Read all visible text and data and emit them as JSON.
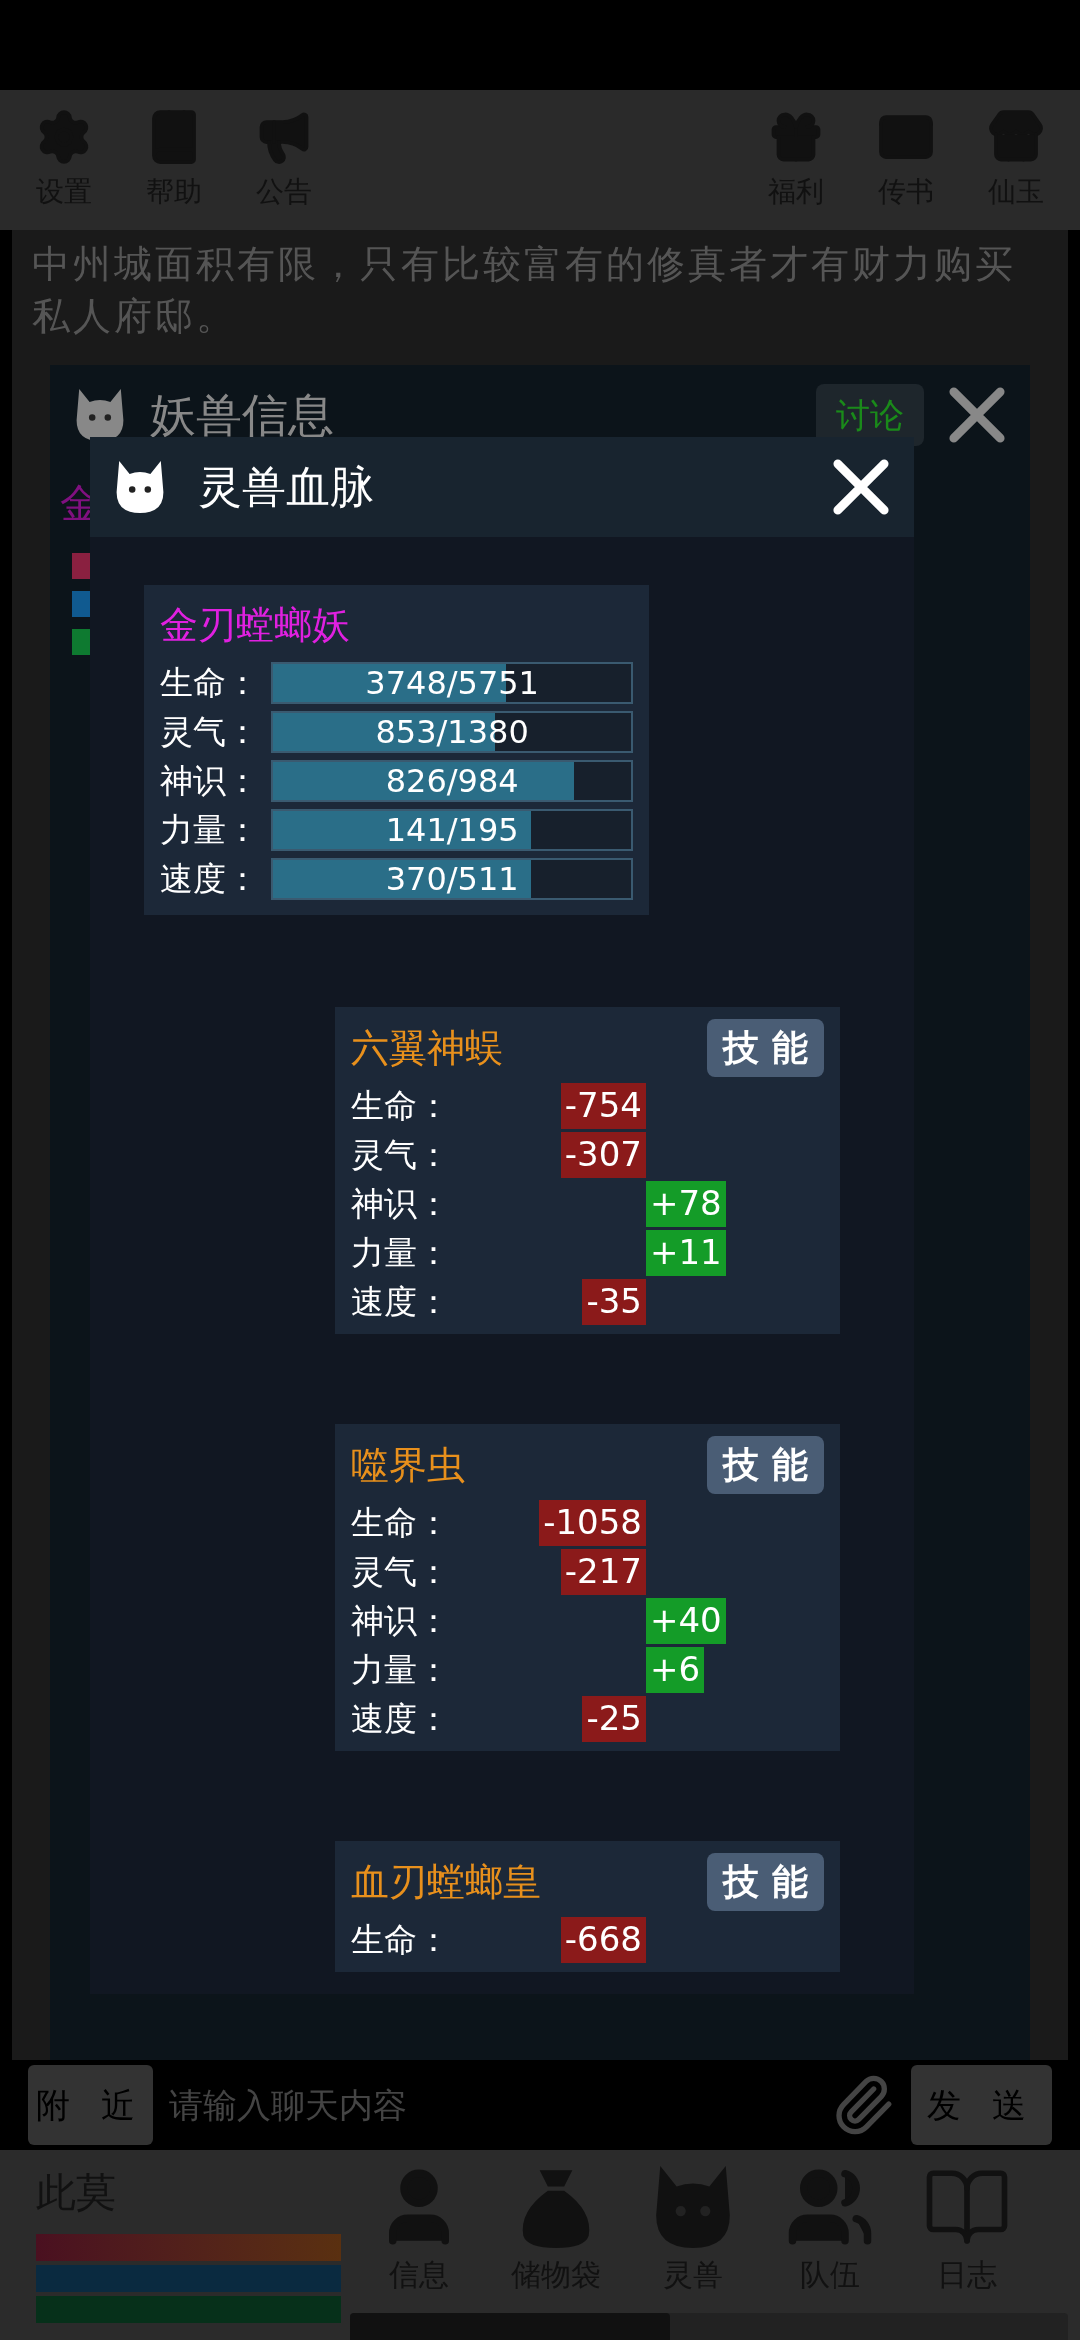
{
  "top_bar": {
    "left": [
      {
        "label": "设置"
      },
      {
        "label": "帮助"
      },
      {
        "label": "公告"
      }
    ],
    "right": [
      {
        "label": "福利"
      },
      {
        "label": "传书"
      },
      {
        "label": "仙玉"
      }
    ]
  },
  "notice": "中州城面积有限，只有比较富有的修真者才有财力购买私人府邸。",
  "beast_panel": {
    "title": "妖兽信息",
    "discuss_button": "讨论",
    "name_fragment": "金"
  },
  "bloodline_dialog": {
    "title": "灵兽血脉",
    "beast": {
      "name": "金刃螳螂妖",
      "stats": [
        {
          "label": "生命：",
          "reading": "3748/5751",
          "level": 0.65
        },
        {
          "label": "灵气：",
          "reading": "853/1380",
          "level": 0.62
        },
        {
          "label": "神识：",
          "reading": "826/984",
          "level": 0.84
        },
        {
          "label": "力量：",
          "reading": "141/195",
          "level": 0.72
        },
        {
          "label": "速度：",
          "reading": "370/511",
          "level": 0.72
        }
      ]
    },
    "bloodlines": [
      {
        "name": "六翼神蜈",
        "skill_button": "技 能",
        "effects": [
          {
            "label": "生命：",
            "value": "-754",
            "kind": "loss"
          },
          {
            "label": "灵气：",
            "value": "-307",
            "kind": "loss"
          },
          {
            "label": "神识：",
            "value": "+78",
            "kind": "gain"
          },
          {
            "label": "力量：",
            "value": "+11",
            "kind": "gain"
          },
          {
            "label": "速度：",
            "value": "-35",
            "kind": "loss"
          }
        ]
      },
      {
        "name": "噬界虫",
        "skill_button": "技 能",
        "effects": [
          {
            "label": "生命：",
            "value": "-1058",
            "kind": "loss"
          },
          {
            "label": "灵气：",
            "value": "-217",
            "kind": "loss"
          },
          {
            "label": "神识：",
            "value": "+40",
            "kind": "gain"
          },
          {
            "label": "力量：",
            "value": "+6",
            "kind": "gain"
          },
          {
            "label": "速度：",
            "value": "-25",
            "kind": "loss"
          }
        ]
      },
      {
        "name": "血刃螳螂皇",
        "skill_button": "技 能",
        "effects": [
          {
            "label": "生命：",
            "value": "-668",
            "kind": "loss"
          }
        ]
      }
    ]
  },
  "chat": {
    "channel": "附 近",
    "placeholder": "请输入聊天内容",
    "send_button": "发 送"
  },
  "player": {
    "name": "此莫"
  },
  "bottom_nav": [
    {
      "label": "信息"
    },
    {
      "label": "储物袋"
    },
    {
      "label": "灵兽"
    },
    {
      "label": "队伍"
    },
    {
      "label": "日志"
    }
  ]
}
